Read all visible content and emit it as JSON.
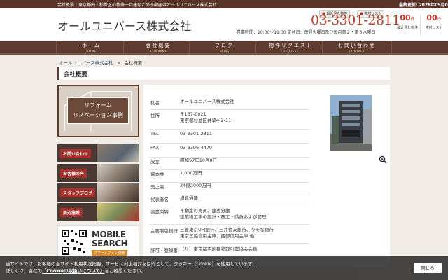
{
  "topbar": {
    "description": "会社概要｜東京都内・杉並区の新築一戸建などの不動産はオールユニバース株式会社",
    "updated": "最終更新: 2026年09月03日"
  },
  "header": {
    "logo": "オールユニバース株式会社",
    "recent_button": "最近見た物件",
    "compare_button": "検討リスト",
    "phone": "03-3301-2811",
    "hours": "営業時間：10:00〜19:00 定休日：毎週火曜日及び毎月第２・第３水曜日",
    "counts": [
      {
        "value": "00",
        "unit": "件",
        "label": "最近見た物件"
      },
      {
        "value": "00",
        "unit": "件",
        "label": "検討リスト"
      }
    ]
  },
  "nav": [
    {
      "jp": "ホーム",
      "en": "HOME"
    },
    {
      "jp": "会社概要",
      "en": "COMPANY"
    },
    {
      "jp": "ブログ",
      "en": "BLOG"
    },
    {
      "jp": "物件リクエスト",
      "en": "REQUEST"
    },
    {
      "jp": "お問い合わせ",
      "en": "CONTACT"
    }
  ],
  "breadcrumb": {
    "home": "オールユニバース株式会社",
    "separator": ">",
    "current": "会社概要"
  },
  "page_title": "会社概要",
  "sidebar": {
    "reform": {
      "line1": "リフォーム",
      "line2": "リノベーション事例"
    },
    "banners": [
      "お問い合わせ",
      "お客様の声",
      "スタッフブログ",
      "周辺施設"
    ],
    "mobile": {
      "title1": "MOBILE",
      "title2": "SEARCH",
      "sub": "スマートフォン検索"
    }
  },
  "company": [
    {
      "key": "社名",
      "lines": [
        "オールユニバース株式会社"
      ]
    },
    {
      "key": "住所",
      "lines": [
        "〒167-0021",
        "東京都杉並区井草4-2-11"
      ]
    },
    {
      "key": "TEL",
      "lines": [
        "03-3301-2811"
      ]
    },
    {
      "key": "FAX",
      "lines": [
        "03-3396-4479"
      ]
    },
    {
      "key": "設立",
      "lines": [
        "昭和57年10月8日"
      ]
    },
    {
      "key": "資本金",
      "lines": [
        "1,000万円"
      ]
    },
    {
      "key": "売上高",
      "lines": [
        "34億2000万円"
      ]
    },
    {
      "key": "代表者名",
      "lines": [
        "横倉通隆"
      ]
    },
    {
      "key": "事業内容",
      "lines": [
        "不動産の売買、建売分譲",
        "建築物工事の設計・施工・請負および管理"
      ]
    },
    {
      "key": "主要取引銀行",
      "lines": [
        "三菱東京UFJ銀行、三井住友銀行、りそな銀行",
        "東京三協信用金庫、西部信用金庫 他"
      ]
    },
    {
      "key": "許可・登録番",
      "lines": [
        "（社）東京都宅地建物取引業協会会員"
      ]
    }
  ],
  "cookie": {
    "line1": "当サイトでは、お客様の当サイト利用状況把握、サービス向上検討を目的として、クッキー（Cookie）を使用しています。",
    "line2_pre": "詳しくは、当社の",
    "link": "「Cookieの取扱いについて」",
    "line2_post": "をご確認ください。",
    "close": "閉じる"
  },
  "colors": {
    "brand_brown": "#5e3b2f",
    "accent_red": "#b5402b"
  }
}
